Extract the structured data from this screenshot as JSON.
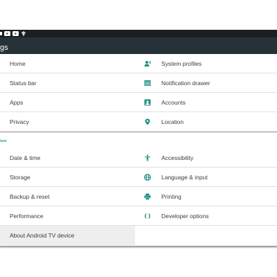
{
  "toolbar": {
    "title": "gs"
  },
  "statusbar": {
    "icons": [
      "notification-icon",
      "youtube-icon",
      "youtube-icon",
      "usb-icon"
    ]
  },
  "accent_color": "#1ea896",
  "icon_color": "#1e8c7e",
  "personal": {
    "left": [
      {
        "label": "Home"
      },
      {
        "label": "Status bar"
      },
      {
        "label": "Apps"
      },
      {
        "label": "Privacy"
      }
    ],
    "right": [
      {
        "label": "System profiles",
        "icon": "profiles-icon"
      },
      {
        "label": "Notification drawer",
        "icon": "notification-drawer-icon"
      },
      {
        "label": "Accounts",
        "icon": "account-box-icon"
      },
      {
        "label": "Location",
        "icon": "location-pin-icon"
      }
    ]
  },
  "system": {
    "header": "tem",
    "left": [
      {
        "label": "Date & time"
      },
      {
        "label": "Storage"
      },
      {
        "label": "Backup & reset"
      },
      {
        "label": "Performance"
      },
      {
        "label": "About Android TV device",
        "selected": true
      }
    ],
    "right": [
      {
        "label": "Accessibility",
        "icon": "accessibility-icon"
      },
      {
        "label": "Language & input",
        "icon": "globe-icon"
      },
      {
        "label": "Printing",
        "icon": "printer-icon"
      },
      {
        "label": "Developer options",
        "icon": "code-braces-icon"
      }
    ]
  }
}
